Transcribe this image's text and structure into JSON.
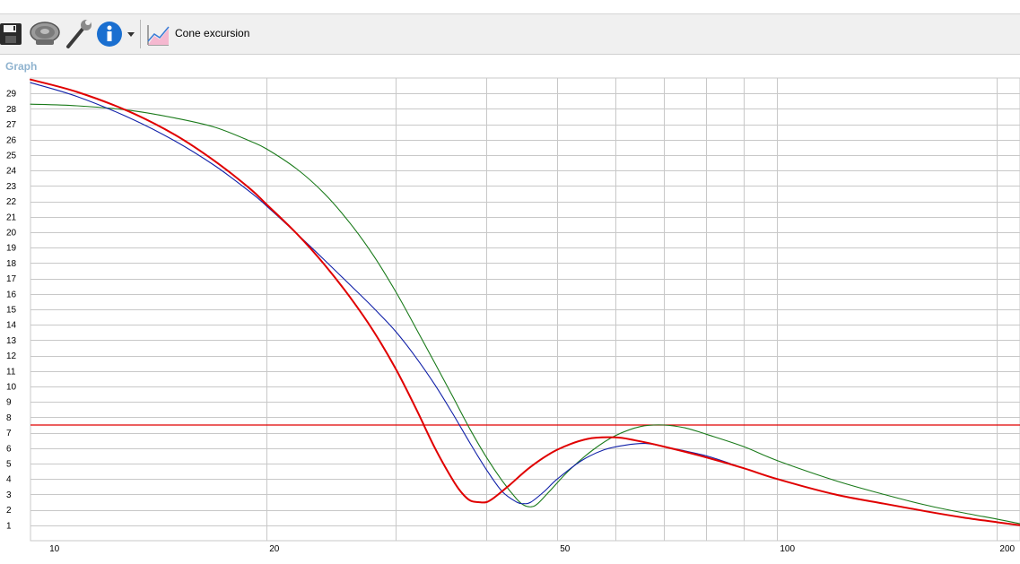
{
  "toolbar": {
    "items": [
      {
        "icon": "save-icon"
      },
      {
        "icon": "speaker-icon"
      },
      {
        "icon": "wrench-icon"
      },
      {
        "icon": "info-icon"
      },
      {
        "icon": "dropdown-arrow-icon"
      }
    ],
    "chart_button_icon": "cone-excursion-chart-icon",
    "chart_button_label": "Cone excursion"
  },
  "panel": {
    "title": "Graph"
  },
  "chart_data": {
    "type": "line",
    "xscale": "log",
    "xlim": [
      9.5,
      215
    ],
    "ylim": [
      0,
      30
    ],
    "x_tick_labels": [
      10,
      20,
      50,
      100,
      200
    ],
    "x_gridlines": [
      20,
      30,
      40,
      50,
      60,
      70,
      80,
      90,
      100,
      200
    ],
    "y_tick_labels": [
      1,
      2,
      3,
      4,
      5,
      6,
      7,
      8,
      9,
      10,
      11,
      12,
      13,
      14,
      15,
      16,
      17,
      18,
      19,
      20,
      21,
      22,
      23,
      24,
      25,
      26,
      27,
      28,
      29
    ],
    "grid": true,
    "colors": {
      "grid": "#c8c8c8",
      "red": "#e00000",
      "blue": "#1020a8",
      "green": "#1a7a1a",
      "limit": "#e00000"
    },
    "limit_line": {
      "y": 7.5
    },
    "series": [
      {
        "color": "#1a7a1a",
        "width": 1.1,
        "points": [
          [
            9.5,
            28.3
          ],
          [
            11,
            28.2
          ],
          [
            13,
            27.9
          ],
          [
            15,
            27.4
          ],
          [
            17,
            26.8
          ],
          [
            19,
            25.9
          ],
          [
            20,
            25.4
          ],
          [
            22,
            24.1
          ],
          [
            24,
            22.5
          ],
          [
            26,
            20.6
          ],
          [
            28,
            18.5
          ],
          [
            30,
            16.2
          ],
          [
            32,
            13.8
          ],
          [
            34,
            11.5
          ],
          [
            36,
            9.3
          ],
          [
            38,
            7.2
          ],
          [
            40,
            5.4
          ],
          [
            42,
            3.9
          ],
          [
            44,
            2.7
          ],
          [
            45,
            2.3
          ],
          [
            46,
            2.2
          ],
          [
            47,
            2.4
          ],
          [
            49,
            3.3
          ],
          [
            52,
            4.6
          ],
          [
            56,
            5.9
          ],
          [
            60,
            6.8
          ],
          [
            65,
            7.4
          ],
          [
            70,
            7.5
          ],
          [
            75,
            7.3
          ],
          [
            80,
            6.9
          ],
          [
            90,
            6.1
          ],
          [
            100,
            5.2
          ],
          [
            120,
            3.9
          ],
          [
            140,
            3.0
          ],
          [
            160,
            2.3
          ],
          [
            180,
            1.8
          ],
          [
            200,
            1.4
          ],
          [
            215,
            1.1
          ]
        ]
      },
      {
        "color": "#1020a8",
        "width": 1.1,
        "points": [
          [
            9.5,
            29.7
          ],
          [
            11,
            28.8
          ],
          [
            13,
            27.4
          ],
          [
            15,
            25.9
          ],
          [
            17,
            24.3
          ],
          [
            19,
            22.6
          ],
          [
            20,
            21.7
          ],
          [
            22,
            19.9
          ],
          [
            24,
            18.2
          ],
          [
            26,
            16.6
          ],
          [
            28,
            15.1
          ],
          [
            30,
            13.6
          ],
          [
            32,
            11.9
          ],
          [
            34,
            10.1
          ],
          [
            36,
            8.2
          ],
          [
            38,
            6.3
          ],
          [
            40,
            4.6
          ],
          [
            42,
            3.2
          ],
          [
            44,
            2.5
          ],
          [
            45,
            2.4
          ],
          [
            46,
            2.5
          ],
          [
            48,
            3.2
          ],
          [
            50,
            4.0
          ],
          [
            54,
            5.2
          ],
          [
            58,
            5.9
          ],
          [
            62,
            6.2
          ],
          [
            66,
            6.3
          ],
          [
            70,
            6.1
          ],
          [
            80,
            5.5
          ],
          [
            90,
            4.7
          ],
          [
            100,
            4.0
          ],
          [
            120,
            3.0
          ],
          [
            140,
            2.4
          ],
          [
            160,
            1.9
          ],
          [
            180,
            1.5
          ],
          [
            200,
            1.2
          ],
          [
            215,
            1.0
          ]
        ]
      },
      {
        "color": "#e00000",
        "width": 2.0,
        "points": [
          [
            9.5,
            29.9
          ],
          [
            11,
            29.1
          ],
          [
            13,
            27.8
          ],
          [
            15,
            26.3
          ],
          [
            17,
            24.6
          ],
          [
            19,
            22.8
          ],
          [
            20,
            21.8
          ],
          [
            22,
            19.9
          ],
          [
            24,
            17.9
          ],
          [
            26,
            15.8
          ],
          [
            28,
            13.6
          ],
          [
            30,
            11.2
          ],
          [
            32,
            8.6
          ],
          [
            34,
            6.0
          ],
          [
            36,
            3.9
          ],
          [
            37,
            3.1
          ],
          [
            38,
            2.6
          ],
          [
            39,
            2.5
          ],
          [
            40,
            2.5
          ],
          [
            41,
            2.8
          ],
          [
            43,
            3.6
          ],
          [
            46,
            4.8
          ],
          [
            50,
            5.9
          ],
          [
            55,
            6.6
          ],
          [
            60,
            6.7
          ],
          [
            64,
            6.5
          ],
          [
            70,
            6.1
          ],
          [
            80,
            5.4
          ],
          [
            90,
            4.7
          ],
          [
            100,
            4.0
          ],
          [
            120,
            3.0
          ],
          [
            140,
            2.4
          ],
          [
            160,
            1.9
          ],
          [
            180,
            1.5
          ],
          [
            200,
            1.2
          ],
          [
            215,
            1.0
          ]
        ]
      }
    ]
  }
}
